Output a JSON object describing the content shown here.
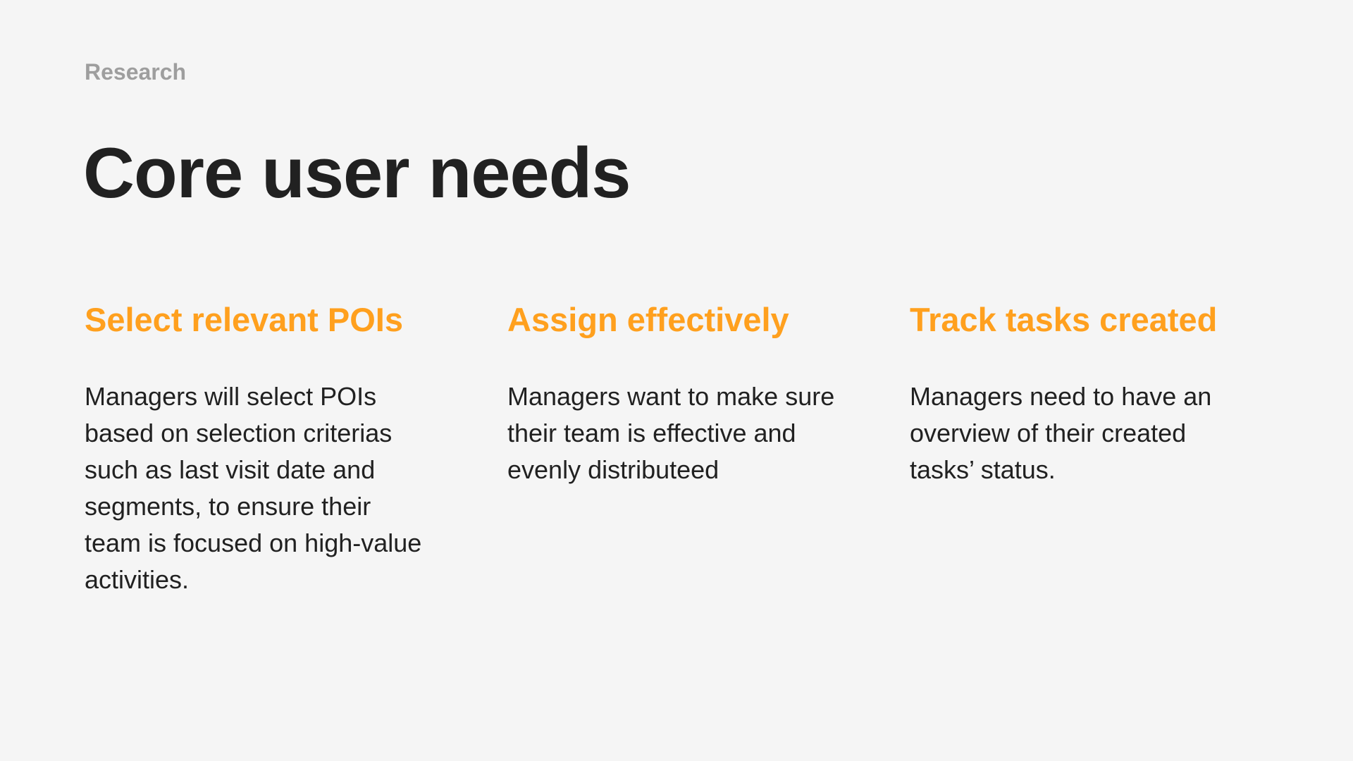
{
  "section_label": "Research",
  "title": "Core user needs",
  "colors": {
    "background": "#f5f5f5",
    "accent": "#ffa01e",
    "heading": "#212121",
    "muted": "#9e9e9e"
  },
  "needs": [
    {
      "title": "Select relevant POIs",
      "text": "Managers will select POIs based on selection criterias such as last visit date and segments, to ensure their team is focused on high-value activities."
    },
    {
      "title": "Assign effectively",
      "text": "Managers want to make sure their team is effective and evenly distributeed"
    },
    {
      "title": "Track tasks created",
      "text": "Managers need to have an overview of their created tasks’ status."
    }
  ]
}
